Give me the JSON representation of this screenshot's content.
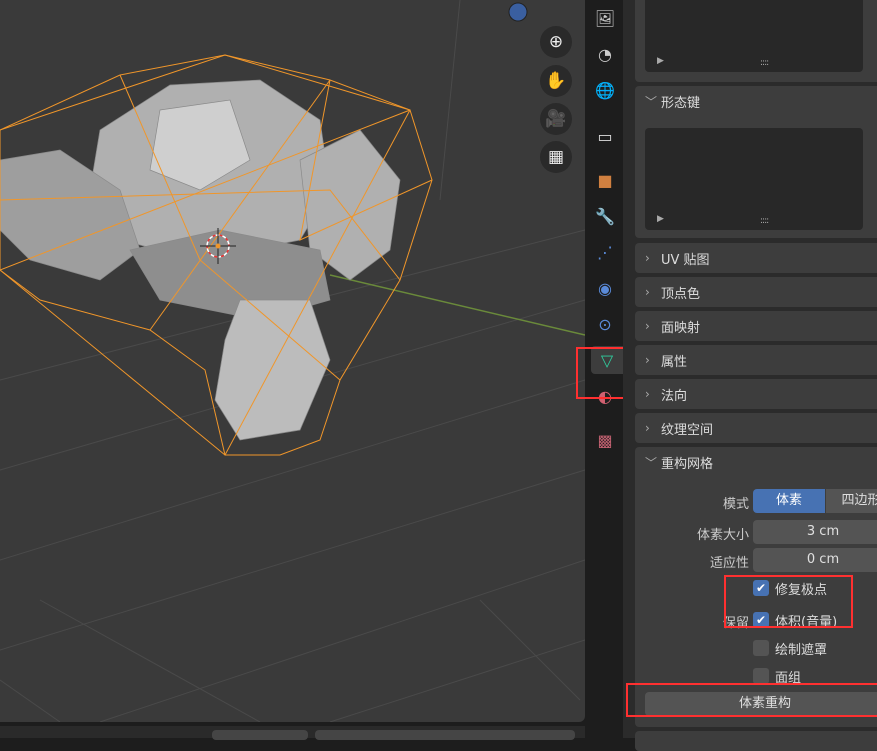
{
  "viewport": {
    "gizmos": [
      "zoom-icon",
      "hand-pan-icon",
      "camera-icon",
      "grid-icon"
    ]
  },
  "tabs": [
    "render-output-icon",
    "view-layer-icon",
    "world-icon",
    "collection-icon",
    "object-icon",
    "modifier-icon",
    "particles-icon",
    "physics-icon",
    "constraints-icon",
    "mesh-data-icon",
    "material-icon",
    "texture-icon"
  ],
  "props": {
    "shape_keys": "形态键",
    "list_grip": "::::",
    "uv_maps": "UV 贴图",
    "vertex_colors": "顶点色",
    "face_maps": "面映射",
    "attributes": "属性",
    "normals": "法向",
    "texture_space": "纹理空间",
    "remesh": {
      "title": "重构网格",
      "mode_label": "模式",
      "mode_options": [
        "体素",
        "四边形"
      ],
      "voxel_size_label": "体素大小",
      "voxel_size": "3 cm",
      "adaptivity_label": "适应性",
      "adaptivity": "0 cm",
      "fix_poles": "修复极点",
      "fix_poles_checked": true,
      "preserve_label": "保留",
      "volume": "体积(音量)",
      "volume_checked": true,
      "paint_mask": "绘制遮罩",
      "paint_mask_checked": false,
      "face_sets": "面组",
      "face_sets_checked": false,
      "button": "体素重构"
    }
  },
  "colors": {
    "accent": "#4772b3",
    "highlight": "#ff3030",
    "wire": "#f0962a"
  }
}
